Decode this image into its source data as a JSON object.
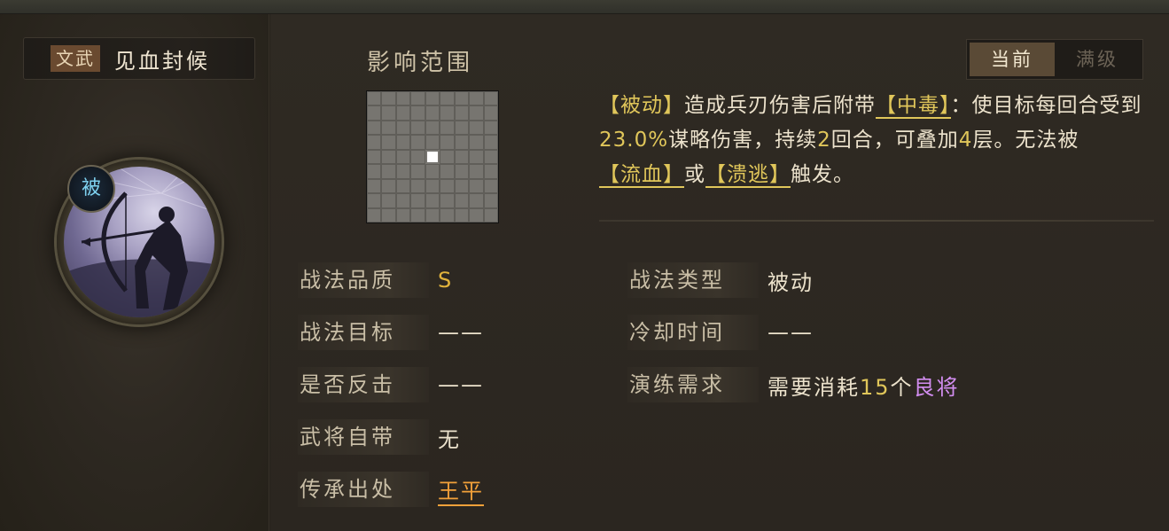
{
  "skill": {
    "tag": "文武",
    "name": "见血封候",
    "passive_badge": "被",
    "icon": "archer-bow-icon"
  },
  "range": {
    "title": "影响范围",
    "grid_size": 9,
    "highlight": [
      4,
      4
    ]
  },
  "tabs": {
    "current": "当前",
    "max": "满级",
    "active": "current"
  },
  "description": {
    "p1": "【被动】",
    "p2": "造成兵刃伤害后附带",
    "p3": "【中毒】",
    "p4": "：使目标每回合受到",
    "p5": "23.0%",
    "p6": "谋略伤害，持续",
    "p7": "2",
    "p8": "回合，可叠加",
    "p9": "4",
    "p10": "层。无法被",
    "p11": "【流血】",
    "p12": "或",
    "p13": "【溃逃】",
    "p14": "触发。"
  },
  "attributes": {
    "quality": {
      "label": "战法品质",
      "value": "S"
    },
    "target": {
      "label": "战法目标",
      "value": "——"
    },
    "counter": {
      "label": "是否反击",
      "value": "——"
    },
    "innate": {
      "label": "武将自带",
      "value": "无"
    },
    "inherit": {
      "label": "传承出处",
      "value": "王平"
    },
    "type": {
      "label": "战法类型",
      "value": "被动"
    },
    "cooldown": {
      "label": "冷却时间",
      "value": "——"
    },
    "training": {
      "label": "演练需求",
      "value_prefix": "需要消耗",
      "value_num": "15",
      "value_unit": "个",
      "value_item": "良将"
    }
  },
  "colors": {
    "accent_gold": "#e0c65a",
    "quality_gold": "#e2b43c",
    "inherit_orange": "#f3a13a",
    "item_purple": "#d28df0",
    "passive_blue": "#7fd2f0"
  }
}
